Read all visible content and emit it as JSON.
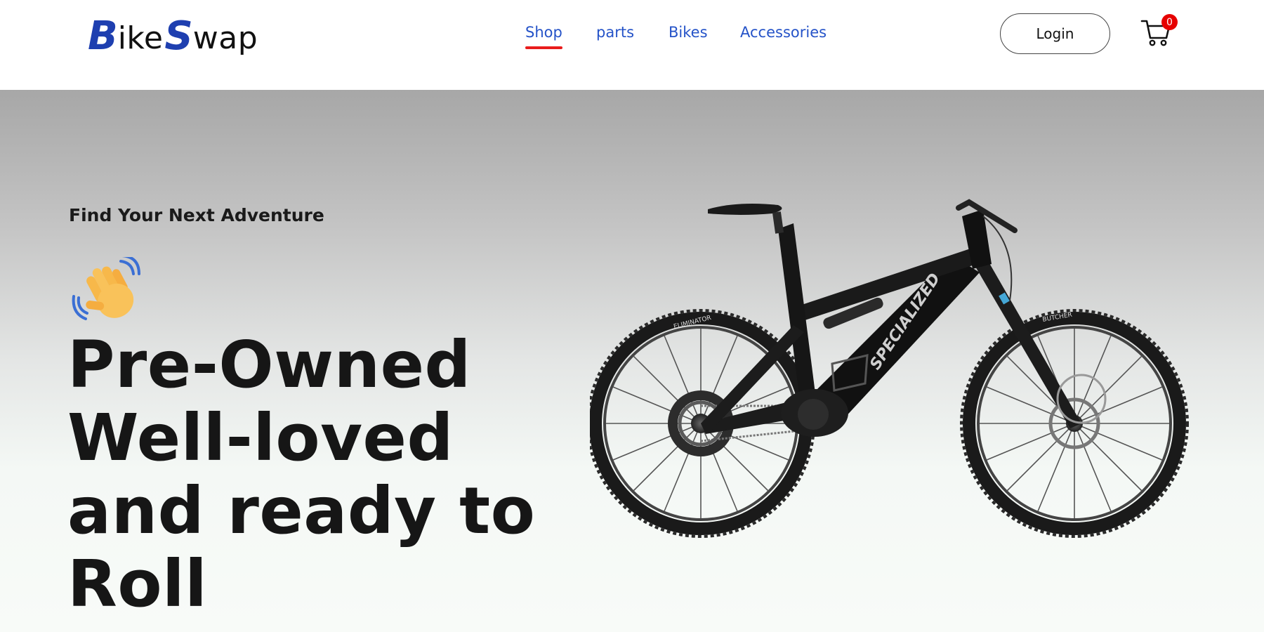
{
  "brand": {
    "logo_b": "B",
    "logo_ike": "ike",
    "logo_s": "S",
    "logo_wap": "wap",
    "primary_color": "#1e3fb0"
  },
  "nav": {
    "items": [
      {
        "label": "Shop",
        "active": true
      },
      {
        "label": "parts",
        "active": false
      },
      {
        "label": "Bikes",
        "active": false
      },
      {
        "label": "Accessories",
        "active": false
      }
    ],
    "link_color": "#2553c8",
    "active_underline_color": "#e91c1c"
  },
  "header": {
    "login_label": "Login",
    "cart_icon": "cart-icon",
    "cart_count": "0"
  },
  "hero": {
    "eyebrow": "Find Your Next Adventure",
    "wave_icon": "waving-hand-icon",
    "headline_lines": [
      "Pre-Owned",
      "Well-loved",
      "and ready to",
      "Roll"
    ],
    "image": "mountain-bike-image",
    "bike_brand_text": "SPECIALIZED",
    "front_tire_text": "BUTCHER",
    "rear_tire_text": "ELIMINATOR"
  }
}
